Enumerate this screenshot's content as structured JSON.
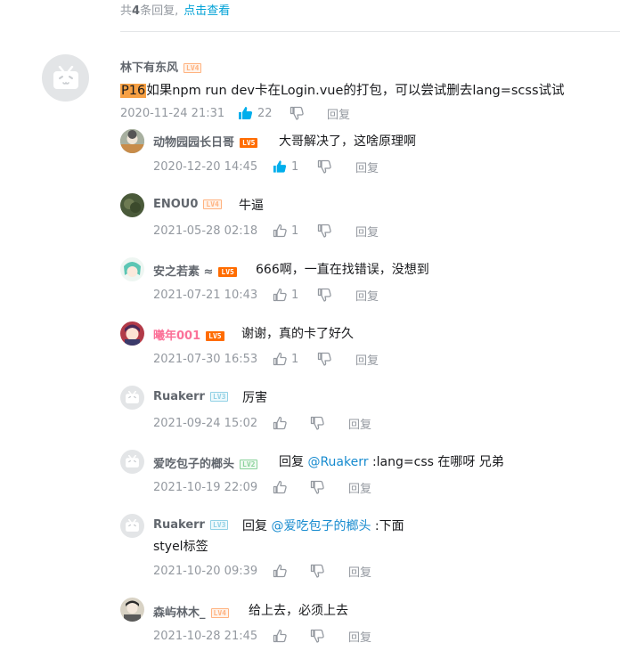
{
  "previous": {
    "prefix": "共",
    "count": "4",
    "suffix": "条回复,",
    "link": "点击查看"
  },
  "main_comment": {
    "user": "林下有东风",
    "level": "LV4",
    "tag": "P16",
    "text": "如果npm run dev卡在Login.vue的打包，可以尝试删去lang=scss试试",
    "time": "2020-11-24 21:31",
    "likes": "22",
    "liked": true,
    "reply_label": "回复"
  },
  "replies": [
    {
      "user": "动物园园长日哥",
      "level": "LV5",
      "text": "大哥解决了，这啥原理啊",
      "time": "2020-12-20 14:45",
      "likes": "1",
      "liked": true,
      "reply_label": "回复"
    },
    {
      "user": "ENOU0",
      "level": "LV4",
      "text": "牛逼",
      "time": "2021-05-28 02:18",
      "likes": "1",
      "reply_label": "回复"
    },
    {
      "user": "安之若素 ≈",
      "level": "LV5",
      "text": "666啊，一直在找错误，没想到",
      "time": "2021-07-21 10:43",
      "likes": "1",
      "reply_label": "回复"
    },
    {
      "user": "曦年001",
      "level": "LV5",
      "text": "谢谢，真的卡了好久",
      "time": "2021-07-30 16:53",
      "likes": "1",
      "reply_label": "回复"
    },
    {
      "user": "Ruakerr",
      "level": "LV3",
      "text": "厉害",
      "time": "2021-09-24 15:02",
      "likes": "",
      "reply_label": "回复"
    },
    {
      "user": "爱吃包子的榔头",
      "level": "LV2",
      "prefix": "回复 ",
      "mention": "@Ruakerr",
      "text": " :lang=css 在哪呀 兄弟",
      "time": "2021-10-19 22:09",
      "likes": "",
      "reply_label": "回复"
    },
    {
      "user": "Ruakerr",
      "level": "LV3",
      "prefix": "回复 ",
      "mention": "@爱吃包子的榔头",
      "text": " :下面",
      "text2": "styel标签",
      "time": "2021-10-20 09:39",
      "likes": "",
      "reply_label": "回复"
    },
    {
      "user": "森屿林木_",
      "level": "LV4",
      "text": "给上去，必须上去",
      "time": "2021-10-28 21:45",
      "likes": "",
      "reply_label": "回复"
    }
  ],
  "colors": {
    "accent": "#00a1d6",
    "like_active": "#00aeec",
    "mention": "#178bcf",
    "tag_bg": "#f7a043"
  }
}
